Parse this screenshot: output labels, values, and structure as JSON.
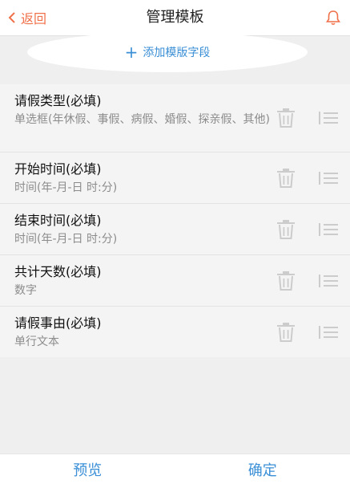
{
  "header": {
    "back_label": "返回",
    "title": "管理模板",
    "icons": {
      "back": "chevron-left-icon",
      "notify": "bell-icon"
    }
  },
  "add_field": {
    "label": "添加模版字段",
    "icon": "plus-icon"
  },
  "fields": [
    {
      "name": "请假类型(必填)",
      "type": "单选框(年休假、事假、病假、婚假、探亲假、其他)"
    },
    {
      "name": "开始时间(必填)",
      "type": "时间(年-月-日 时:分)"
    },
    {
      "name": "结束时间(必填)",
      "type": "时间(年-月-日 时:分)"
    },
    {
      "name": "共计天数(必填)",
      "type": "数字"
    },
    {
      "name": "请假事由(必填)",
      "type": "单行文本"
    }
  ],
  "footer": {
    "preview_label": "预览",
    "confirm_label": "确定"
  },
  "colors": {
    "accent": "#f0704a",
    "link": "#3a8fd6",
    "background": "#efeff0",
    "icon_gray": "#cccccc"
  }
}
